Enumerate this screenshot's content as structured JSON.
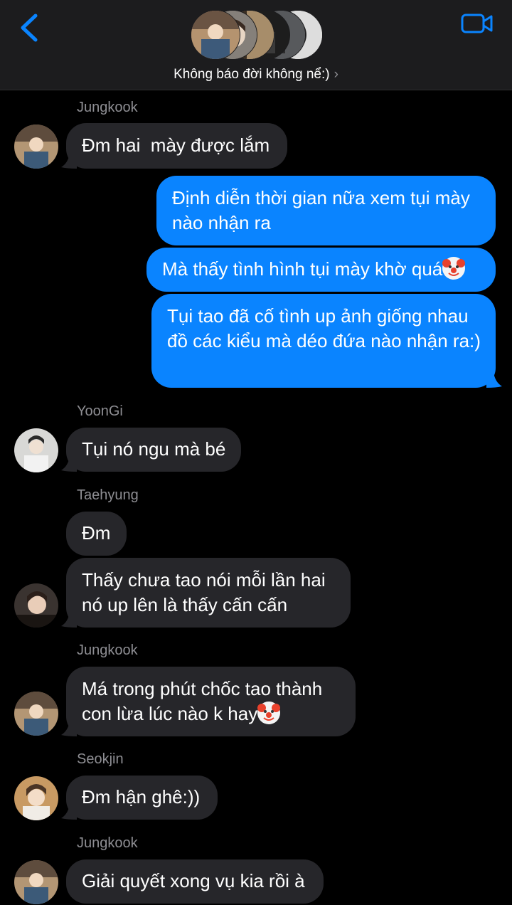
{
  "header": {
    "title": "Không báo đời không nể:)",
    "back_icon": "chevron-left-icon",
    "video_icon": "video-camera-icon",
    "accent": "#0a84ff"
  },
  "messages": [
    {
      "sender": "Jungkook",
      "text": "Đm hai  mày được lắm"
    },
    {
      "sender": "me",
      "text": "Định diễn thời gian nữa xem tụi mày nào nhận ra"
    },
    {
      "sender": "me",
      "text": "Mà thấy tình hình tụi mày khờ quá"
    },
    {
      "sender": "me",
      "text": "Tụi tao đã cố tình up ảnh giống nhau đồ các kiểu mà déo đứa nào nhận ra:)"
    },
    {
      "sender": "YoonGi",
      "text": "Tụi nó ngu mà bé"
    },
    {
      "sender": "Taehyung",
      "text": "Đm"
    },
    {
      "sender": "Taehyung",
      "text": "Thấy chưa tao nói mỗi lần hai nó up lên là thấy cấn cấn"
    },
    {
      "sender": "Jungkook",
      "text": "Má trong phút chốc tao thành con lừa lúc nào k hay"
    },
    {
      "sender": "Seokjin",
      "text": "Đm hận ghê:))"
    },
    {
      "sender": "Jungkook",
      "text": "Giải quyết xong vụ kia rồi à"
    }
  ],
  "names": {
    "n1": "Jungkook",
    "n2": "YoonGi",
    "n3": "Taehyung",
    "n4": "Jungkook",
    "n5": "Seokjin",
    "n6": "Jungkook"
  },
  "colors": {
    "incoming_bubble": "#26262a",
    "outgoing_bubble": "#0a84ff",
    "header_bg": "#1c1c1e"
  }
}
